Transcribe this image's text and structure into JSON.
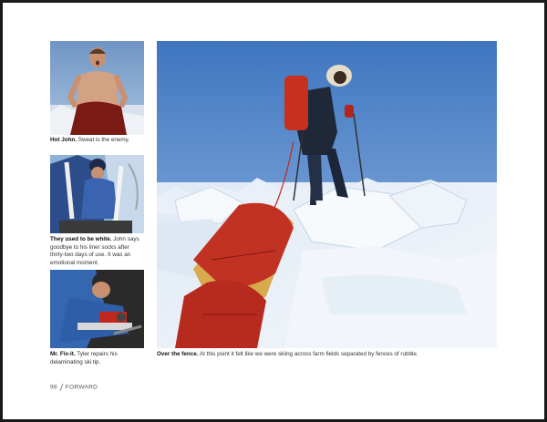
{
  "captions": [
    {
      "bold": "Hot John.",
      "text": "Sweat is the enemy."
    },
    {
      "bold": "They used to be white.",
      "text": "John says goodbye to his liner socks after thirty-two days of use. It was an emotional moment."
    },
    {
      "bold": "Mr. Fix-it.",
      "text": "Tyler repairs his delaminating ski tip."
    },
    {
      "bold": "Over the fence.",
      "text": "At this point it felt like we were skiing across farm fields separated by fences of rubble."
    }
  ],
  "footer": {
    "page_number": "98",
    "section": "FORWARD"
  },
  "colors": {
    "sky": "#5c8cc8",
    "ice": "#e8eef5",
    "sled_red": "#c0281e"
  }
}
